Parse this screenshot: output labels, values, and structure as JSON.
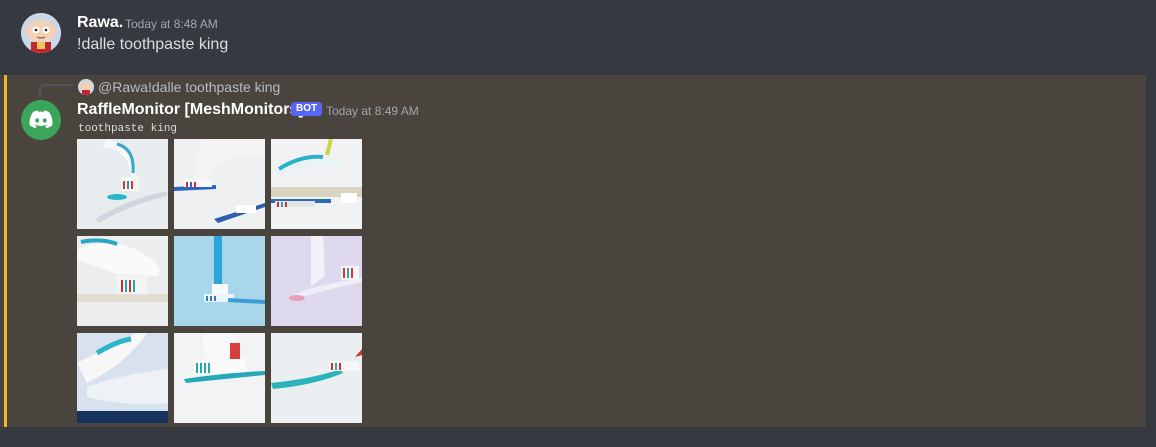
{
  "messages": {
    "first": {
      "author": "Rawa.",
      "timestamp": "Today at 8:48 AM",
      "text": "!dalle toothpaste king"
    },
    "second": {
      "reply": {
        "author": "@Rawa.",
        "text": "!dalle toothpaste king"
      },
      "author": "RaffleMonitor [MeshMonitors]",
      "badge": "BOT",
      "timestamp": "Today at 8:49 AM",
      "code_text": "toothpaste king",
      "images": [
        {
          "icon": "toothbrush-image"
        },
        {
          "icon": "toothbrush-image"
        },
        {
          "icon": "toothbrush-image"
        },
        {
          "icon": "toothbrush-image"
        },
        {
          "icon": "toothbrush-image"
        },
        {
          "icon": "toothbrush-image"
        },
        {
          "icon": "toothbrush-image"
        },
        {
          "icon": "toothbrush-image"
        },
        {
          "icon": "toothbrush-image"
        }
      ]
    }
  },
  "colors": {
    "background": "#36393f",
    "mention_highlight": "#49443e",
    "mention_bar": "#f0b232",
    "bot_badge": "#5865f2",
    "discord_avatar": "#3ba55c"
  }
}
